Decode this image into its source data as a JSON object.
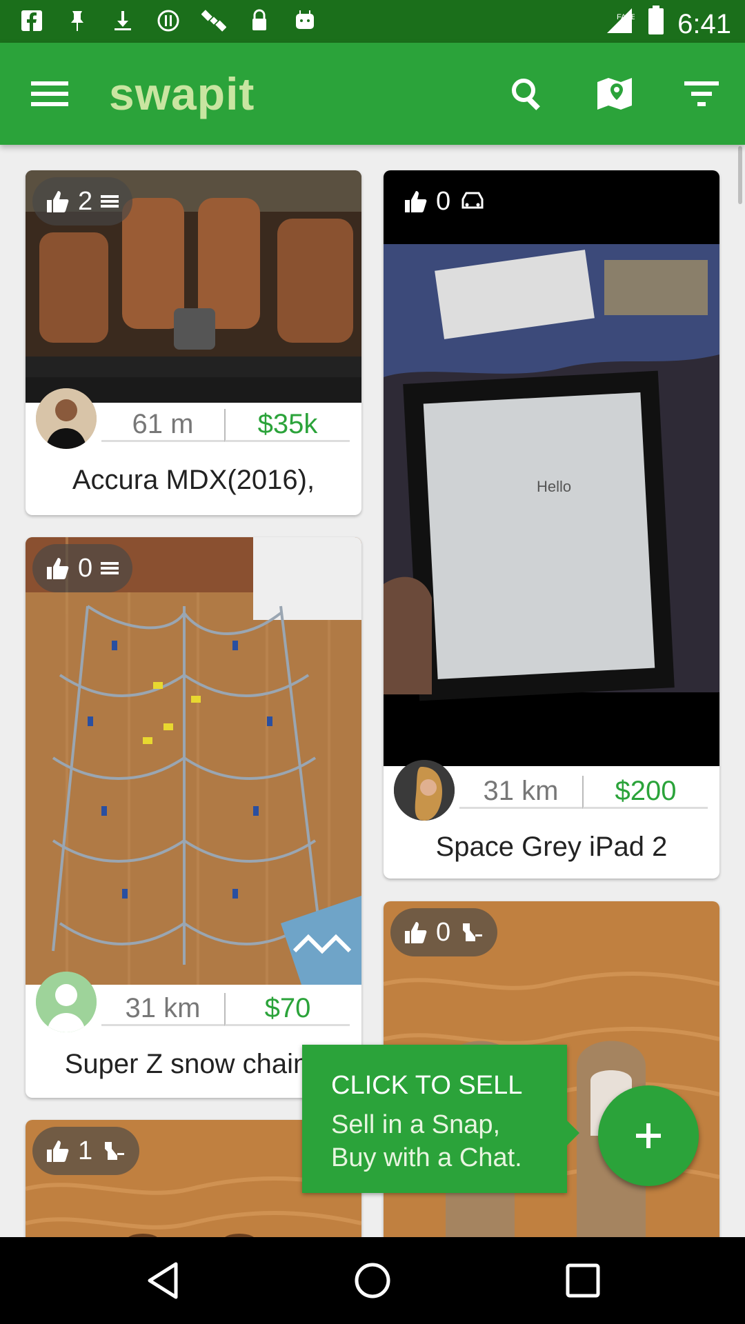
{
  "status_bar": {
    "time": "6:41"
  },
  "app": {
    "logo": "swapit"
  },
  "colors": {
    "primary": "#2BA33A",
    "status_bar": "#1B6F1B",
    "price": "#2BA33A"
  },
  "listings": [
    {
      "likes": "2",
      "icon": "list-icon",
      "distance": "61 m",
      "price": "$35k",
      "title": "Accura MDX(2016),"
    },
    {
      "likes": "0",
      "icon": "car-icon",
      "distance": "31 km",
      "price": "$200",
      "title": "Space Grey iPad 2"
    },
    {
      "likes": "0",
      "icon": "list-icon",
      "distance": "31 km",
      "price": "$70",
      "title": "Super Z snow chains"
    },
    {
      "likes": "0",
      "icon": "hanger-icon"
    },
    {
      "likes": "1",
      "icon": "hanger-icon"
    }
  ],
  "photos": {
    "ipad_screen_text": "Hello"
  },
  "sell_prompt": {
    "heading": "CLICK TO SELL",
    "line1": "Sell in a Snap,",
    "line2": "Buy with a Chat."
  }
}
